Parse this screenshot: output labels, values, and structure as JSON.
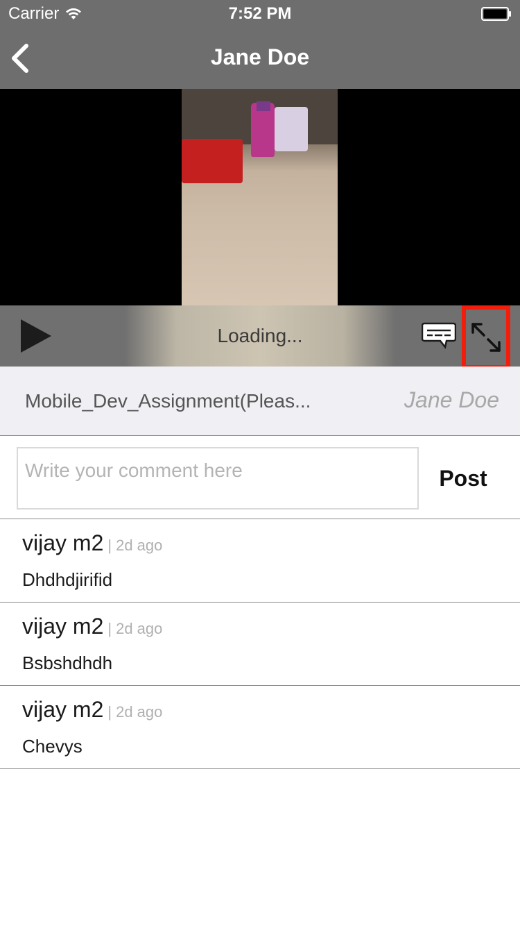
{
  "status_bar": {
    "carrier": "Carrier",
    "time": "7:52 PM"
  },
  "nav": {
    "title": "Jane Doe",
    "back_icon": "chevron-left-icon"
  },
  "player": {
    "loading_text": "Loading...",
    "play_icon": "play-icon",
    "captions_icon": "captions-icon",
    "fullscreen_icon": "fullscreen-expand-icon",
    "highlight_color": "#f21d0b"
  },
  "video_info": {
    "title": "Mobile_Dev_Assignment(Pleas...",
    "author": "Jane Doe"
  },
  "comment_box": {
    "placeholder": "Write your comment here",
    "value": "",
    "post_label": "Post"
  },
  "comments": [
    {
      "author": "vijay m2",
      "separator": "|",
      "time": "2d ago",
      "text": "Dhdhdjirifid"
    },
    {
      "author": "vijay m2",
      "separator": "|",
      "time": "2d ago",
      "text": "Bsbshdhdh"
    },
    {
      "author": "vijay m2",
      "separator": "|",
      "time": "2d ago",
      "text": "Chevys"
    }
  ],
  "colors": {
    "header_bg": "#6e6e6e",
    "info_bg": "#efeff4",
    "author_placeholder": "#a8a8a8"
  }
}
